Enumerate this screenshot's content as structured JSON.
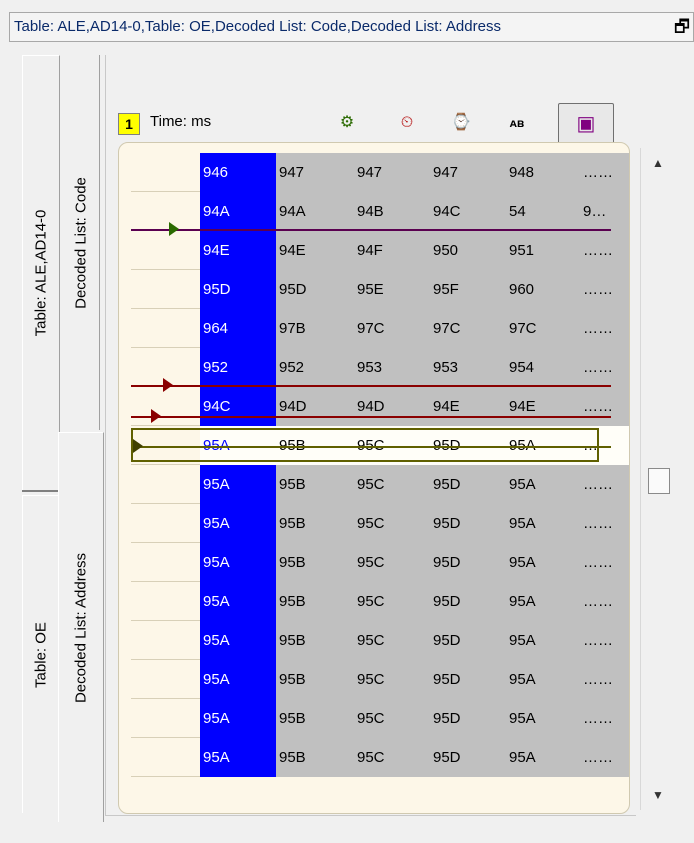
{
  "window": {
    "title": "Table: ALE,AD14-0,Table: OE,Decoded List: Code,Decoded List: Address",
    "restore_glyph": "🗗"
  },
  "tabs": {
    "outer": [
      "Table: ALE,AD14-0",
      "Table: OE"
    ],
    "inner": [
      "Decoded List: Code",
      "Decoded List: Address"
    ]
  },
  "toolbar": {
    "page_number": "1",
    "time_label": "Time:  ms",
    "icons": [
      "gear-icon",
      "clock-icon",
      "search-icon",
      "text-icon",
      "code-view-icon"
    ],
    "icon_glyphs": [
      "⚙",
      "⏲",
      "⌚",
      "ᴀʙ",
      "▣"
    ]
  },
  "list": {
    "rows": [
      [
        "946",
        "947",
        "947",
        "947",
        "948",
        "……"
      ],
      [
        "94A",
        "94A",
        "94B",
        "94C",
        "54",
        "9…"
      ],
      [
        "94E",
        "94E",
        "94F",
        "950",
        "951",
        "……"
      ],
      [
        "95D",
        "95D",
        "95E",
        "95F",
        "960",
        "……"
      ],
      [
        "964",
        "97B",
        "97C",
        "97C",
        "97C",
        "……"
      ],
      [
        "952",
        "952",
        "953",
        "953",
        "954",
        "……"
      ],
      [
        "94C",
        "94D",
        "94D",
        "94E",
        "94E",
        "……"
      ],
      [
        "95A",
        "95B",
        "95C",
        "95D",
        "95A",
        "…"
      ],
      [
        "95A",
        "95B",
        "95C",
        "95D",
        "95A",
        "……"
      ],
      [
        "95A",
        "95B",
        "95C",
        "95D",
        "95A",
        "……"
      ],
      [
        "95A",
        "95B",
        "95C",
        "95D",
        "95A",
        "……"
      ],
      [
        "95A",
        "95B",
        "95C",
        "95D",
        "95A",
        "……"
      ],
      [
        "95A",
        "95B",
        "95C",
        "95D",
        "95A",
        "……"
      ],
      [
        "95A",
        "95B",
        "95C",
        "95D",
        "95A",
        "……"
      ],
      [
        "95A",
        "95B",
        "95C",
        "95D",
        "95A",
        "……"
      ],
      [
        "95A",
        "95B",
        "95C",
        "95D",
        "95A",
        "……"
      ]
    ],
    "selected_row": 7
  },
  "scrollbar": {
    "up_glyph": "▲",
    "down_glyph": "▼"
  },
  "colors": {
    "code_column": "#0000ff",
    "data_cells": "#c0c0c0",
    "marker_red": "#8a0000",
    "marker_purple": "#5a0050",
    "marker_green": "#2a6a00"
  }
}
